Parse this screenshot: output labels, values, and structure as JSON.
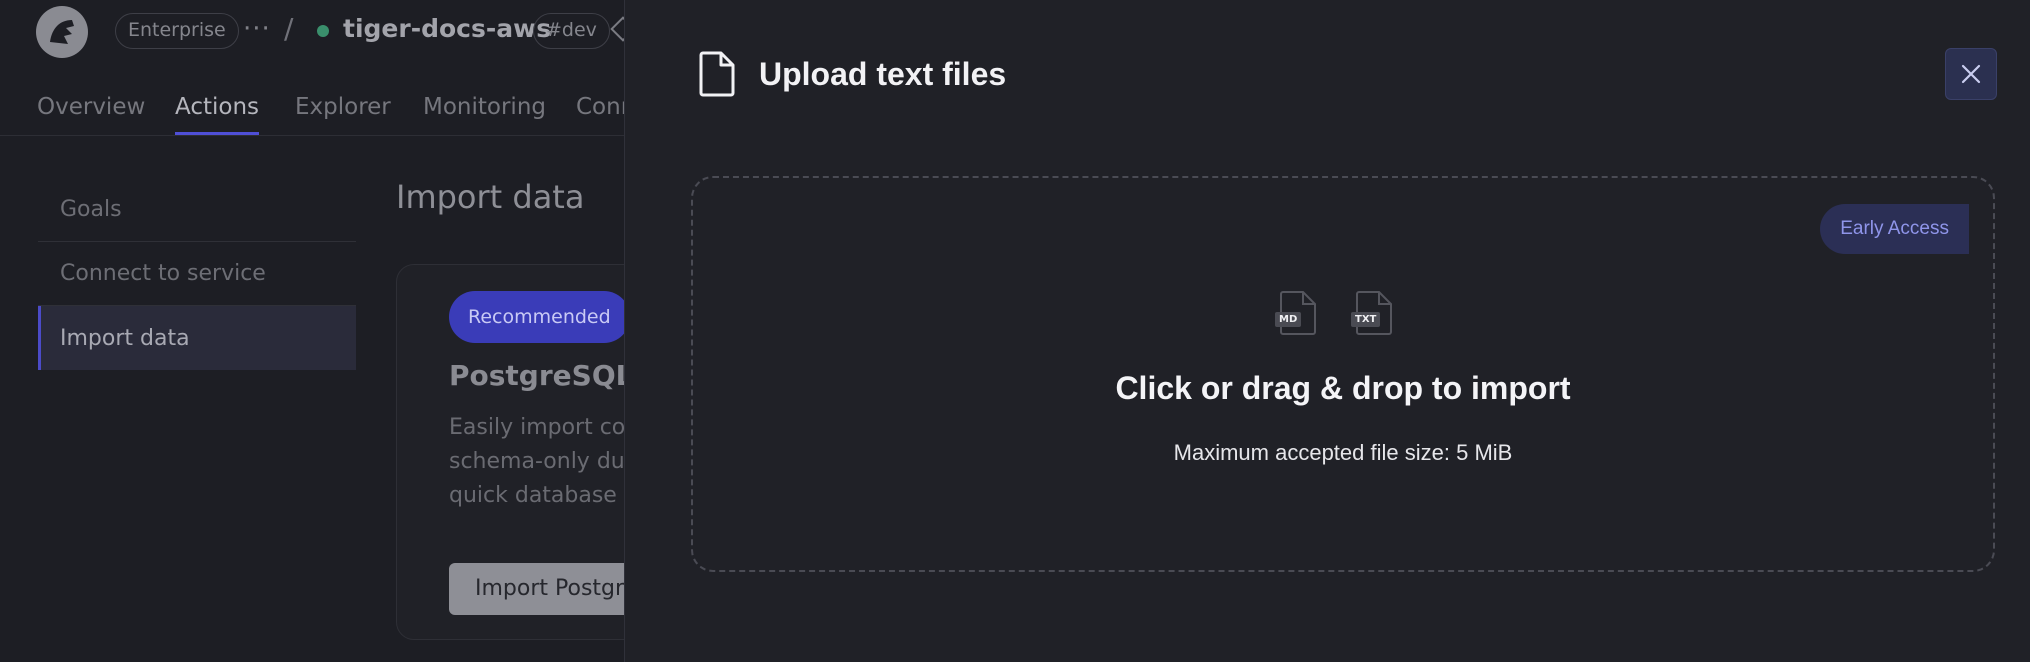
{
  "topbar": {
    "plan_chip": "Enterprise",
    "more": "···",
    "separator": "/",
    "service_name": "tiger-docs-aws",
    "env_chip": "#dev"
  },
  "nav": {
    "tabs": [
      {
        "label": "Overview"
      },
      {
        "label": "Actions"
      },
      {
        "label": "Explorer"
      },
      {
        "label": "Monitoring"
      },
      {
        "label": "Conn"
      }
    ],
    "active_tab": "Actions"
  },
  "sidebar": {
    "items": [
      {
        "label": "Goals"
      },
      {
        "label": "Connect to service"
      },
      {
        "label": "Import data"
      }
    ]
  },
  "content": {
    "title": "Import data",
    "card": {
      "badge": "Recommended",
      "title": "PostgreSQL I",
      "desc_lines": [
        "Easily import cor",
        "schema-only dur",
        "quick database a"
      ],
      "button": "Import Postgre"
    }
  },
  "modal": {
    "title": "Upload text files",
    "dropzone": {
      "badge": "Early Access",
      "file_types": [
        "MD",
        "TXT"
      ],
      "title": "Click or drag & drop to import",
      "subtitle": "Maximum accepted file size: 5 MiB"
    }
  },
  "colors": {
    "accent": "#4f4fd6",
    "badge_bg": "#2b2f55",
    "badge_text": "#8f95ea",
    "panel_bg": "#202127"
  }
}
